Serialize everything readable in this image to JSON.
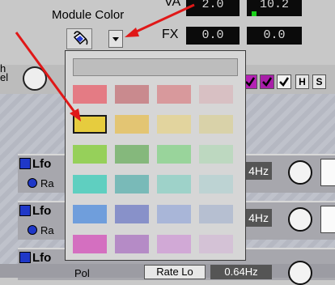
{
  "header": {
    "module_color_label": "Module Color",
    "va_label": "VA",
    "fx_label": "FX",
    "va_values": [
      "2.0",
      "10.2"
    ],
    "fx_values": [
      "0.0",
      "0.0"
    ]
  },
  "toolbar": {
    "h_label": "H",
    "s_label": "S"
  },
  "left_fragment": "h\nel",
  "lfo_modules": [
    {
      "title": "Lfo",
      "radio_label": "Ra",
      "rate": "4Hz"
    },
    {
      "title": "Lfo",
      "radio_label": "Ra",
      "rate": "4Hz"
    },
    {
      "title": "Lfo",
      "radio_label": "Ra",
      "rate": ""
    }
  ],
  "bottom": {
    "label_fragment": "Pol",
    "rate_lo_label": "Rate Lo",
    "rate_lo_value": "0.64Hz"
  },
  "picker": {
    "top_swatch_color": "#bdbdbd",
    "rows": [
      [
        "#e47b84",
        "#c98a8e",
        "#d8999c",
        "#d8c0c3"
      ],
      [
        "#e6cc3e",
        "#e3c573",
        "#e2d49e",
        "#d9d2a9"
      ],
      [
        "#96d05a",
        "#85b87c",
        "#99d49b",
        "#bdd8c0"
      ],
      [
        "#5fcfc0",
        "#79bab8",
        "#9ed2c9",
        "#bdd3d3"
      ],
      [
        "#6f9edc",
        "#8891c9",
        "#a9b6d8",
        "#b6bfd1"
      ],
      [
        "#d46fc0",
        "#b58bc6",
        "#d1a9d6",
        "#d4c2d6"
      ]
    ],
    "selected": [
      1,
      0
    ]
  },
  "colors": {
    "arrow": "#e01818",
    "checkbox_purple": "#b422b4",
    "lfo_icon_blue": "#1f38c8",
    "lcd_bg": "#0b0b0b",
    "meter_green": "#1ad11a"
  }
}
